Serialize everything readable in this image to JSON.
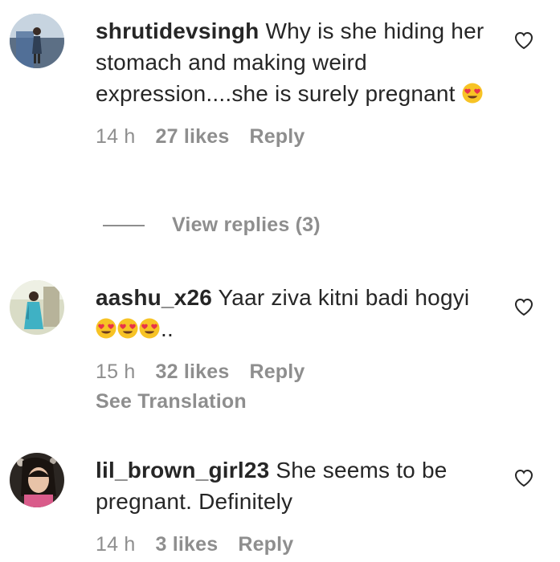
{
  "comments": [
    {
      "username": "shrutidevsingh",
      "text": "Why is she hiding her stomach and making weird expression....she is surely pregnant",
      "emoji_count": 1,
      "trailing": "",
      "time": "14 h",
      "likes": "27 likes",
      "reply": "Reply"
    },
    {
      "username": "aashu_x26",
      "text": "Yaar ziva kitni badi hogyi",
      "emoji_count": 3,
      "trailing": "..",
      "time": "15 h",
      "likes": "32 likes",
      "reply": "Reply",
      "see_translation": "See Translation"
    },
    {
      "username": "lil_brown_girl23",
      "text": "She seems to be pregnant. Definitely",
      "emoji_count": 0,
      "trailing": "",
      "time": "14 h",
      "likes": "3 likes",
      "reply": "Reply"
    }
  ],
  "view_replies": "View replies (3)",
  "icons": {
    "heart": "heart-outline-icon",
    "emoji": "heart-eyes-emoji-icon"
  },
  "colors": {
    "text": "#262626",
    "secondary": "#8e8e8e",
    "emoji_face": "#f7c325",
    "emoji_heart": "#e8334a"
  }
}
